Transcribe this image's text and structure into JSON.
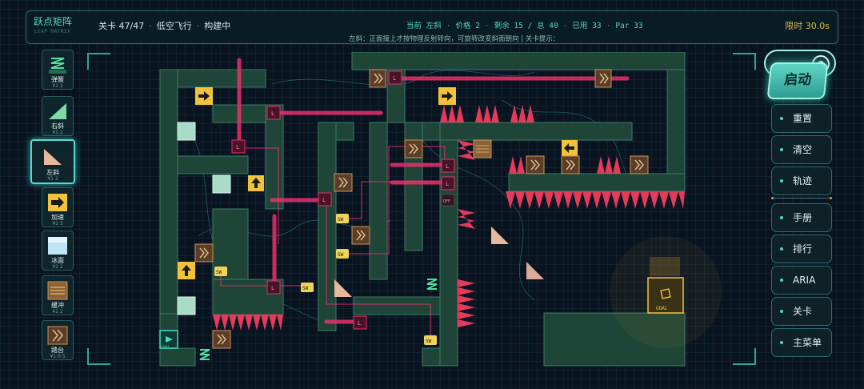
{
  "header": {
    "brand": "跃点矩阵",
    "brand_sub": "LEAP MATRIX",
    "level": "关卡 47/47",
    "level_name": "低空飞行",
    "mode": "构建中",
    "current_label": "当前",
    "current_piece": "左斜",
    "price": "价格 2",
    "remaining": "剩余 15 / 总 40",
    "used": "已用 33",
    "par": "Par 33",
    "tip": "左斜：正面撞上才按物理反射转向，可旋转改变斜面朝向 | 关卡提示：",
    "timer": "限时 30.0s"
  },
  "palette": [
    {
      "name": "spring",
      "label": "弹簧",
      "count": "¥1 2",
      "icon": "spring-icon"
    },
    {
      "name": "right-slope",
      "label": "右斜",
      "count": "¥1 2",
      "icon": "right-slope-icon"
    },
    {
      "name": "left-slope",
      "label": "左斜",
      "count": "¥1 2",
      "icon": "left-slope-icon",
      "selected": true
    },
    {
      "name": "booster",
      "label": "加速",
      "count": "¥1 3",
      "icon": "booster-arrow-icon"
    },
    {
      "name": "ice",
      "label": "冰面",
      "count": "¥1 2",
      "icon": "ice-block-icon"
    },
    {
      "name": "buffer",
      "label": "缓冲",
      "count": "¥1 2",
      "icon": "buffer-icon"
    },
    {
      "name": "jump-pad",
      "label": "踏台",
      "count": "¥1 0.5",
      "icon": "jump-pad-icon"
    }
  ],
  "board": {
    "goal_label": "GOAL",
    "switch_label": "SW",
    "lever_label": "L",
    "off_label": "OFF",
    "start_label": "START"
  },
  "controls": {
    "launch": "启动",
    "buttons": [
      "重置",
      "清空",
      "轨迹",
      "手册",
      "排行",
      "ARIA",
      "关卡",
      "主菜单"
    ]
  },
  "colors": {
    "wall": "#1f4538",
    "wall_edge": "#3b7a64",
    "laser": "#e8306a",
    "spike": "#e63a5c",
    "booster": "#f2c33a",
    "buffer": "#7a5a3a",
    "accent": "#58d6c4"
  }
}
